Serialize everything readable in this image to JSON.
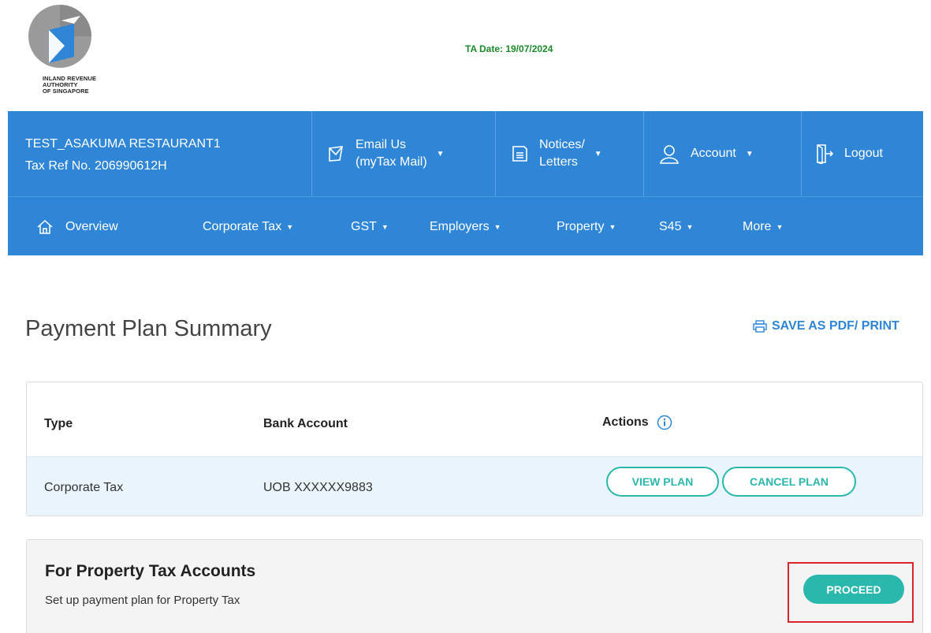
{
  "header": {
    "logo_lines": [
      "INLAND REVENUE",
      "AUTHORITY",
      "OF SINGAPORE"
    ],
    "ta_date": "TA Date: 19/07/2024"
  },
  "account_bar": {
    "org_name": "TEST_ASAKUMA RESTAURANT1",
    "tax_ref": "Tax Ref No. 206990612H",
    "email": {
      "line1": "Email Us",
      "line2": "(myTax Mail)"
    },
    "notices": {
      "line1": "Notices/",
      "line2": "Letters"
    },
    "account_label": "Account",
    "logout_label": "Logout"
  },
  "nav": {
    "overview": "Overview",
    "corporate_tax": "Corporate Tax",
    "gst": "GST",
    "employers": "Employers",
    "property": "Property",
    "s45": "S45",
    "more": "More"
  },
  "page": {
    "title": "Payment Plan Summary",
    "save_pdf": "SAVE AS PDF/ PRINT"
  },
  "table": {
    "headers": {
      "type": "Type",
      "bank_account": "Bank Account",
      "actions": "Actions"
    },
    "rows": [
      {
        "type": "Corporate Tax",
        "bank_account": "UOB XXXXXX9883",
        "view_label": "VIEW PLAN",
        "cancel_label": "CANCEL PLAN"
      }
    ]
  },
  "property_section": {
    "title": "For Property Tax Accounts",
    "subtitle": "Set up payment plan for Property Tax",
    "button": "PROCEED"
  },
  "colors": {
    "nav_blue": "#2f86d7",
    "teal": "#2ab7ac",
    "date_green": "#1b8a2a",
    "highlight_red": "#d9252a"
  }
}
